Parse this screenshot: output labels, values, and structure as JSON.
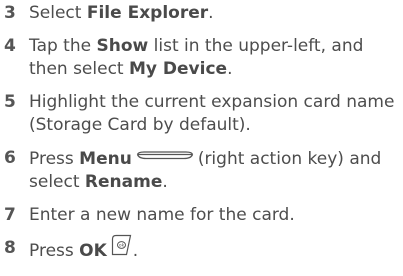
{
  "steps": [
    {
      "num": "3",
      "parts": [
        "Select ",
        "File Explorer",
        "."
      ]
    },
    {
      "num": "4",
      "parts": [
        "Tap the ",
        "Show",
        " list in the upper-left, and then select ",
        "My Device",
        "."
      ]
    },
    {
      "num": "5",
      "text": "Highlight the current expansion card name (Storage Card by default)."
    },
    {
      "num": "6",
      "parts": [
        "Press ",
        "Menu",
        "(right action key) and select ",
        "Rename",
        "."
      ],
      "icon": "right-action-key-icon"
    },
    {
      "num": "7",
      "text": "Enter a new name for the card."
    },
    {
      "num": "8",
      "parts": [
        "Press ",
        "OK",
        "."
      ],
      "icon": "ok-button-icon"
    }
  ],
  "colors": {
    "text": "#4d4d4d",
    "number": "#555555"
  }
}
